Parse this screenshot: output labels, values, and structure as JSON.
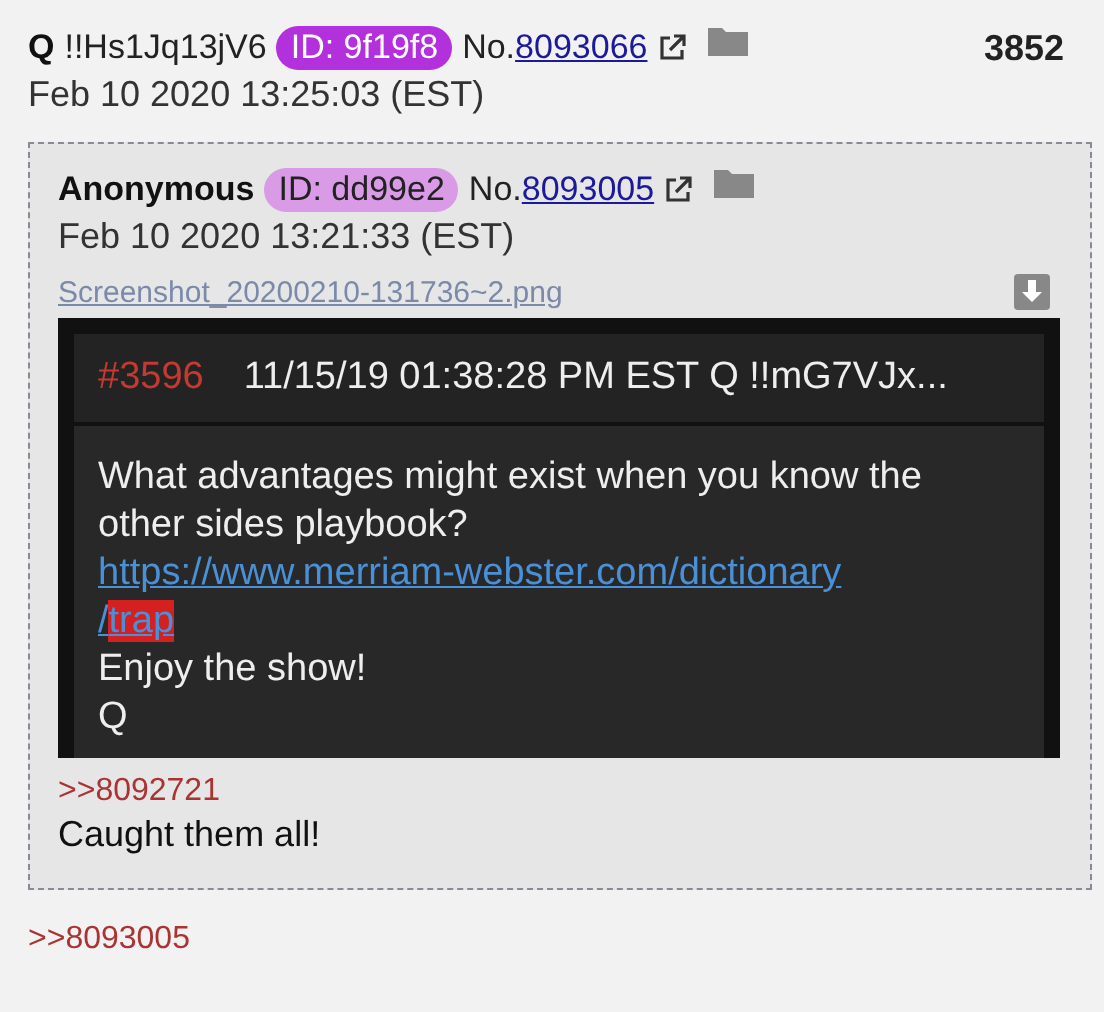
{
  "post": {
    "name": "Q",
    "tripcode": "!!Hs1Jq13jV6",
    "id_badge": {
      "text": "ID: 9f19f8",
      "color": "#b330dd"
    },
    "no_label": "No.",
    "number": "8093066",
    "count": "3852",
    "date": "Feb 10 2020 13:25:03 (EST)"
  },
  "quoted_post": {
    "name": "Anonymous",
    "id_badge": {
      "text": "ID: dd99e2",
      "color": "#d99be6"
    },
    "no_label": "No.",
    "number": "8093005",
    "date": "Feb 10 2020 13:21:33 (EST)",
    "file_name": "Screenshot_20200210-131736~2.png",
    "attachment": {
      "post_number": "#3596",
      "header": "11/15/19 01:38:28 PM EST Q !!mG7VJx...",
      "text": "What advantages might exist when you know the other sides playbook?",
      "link_lines": [
        [
          {
            "text": "https://www.merriam-webster.com/dictionary",
            "highlighted": false
          }
        ],
        [
          {
            "text": "/",
            "highlighted": false
          },
          {
            "text": "trap",
            "highlighted": true
          }
        ]
      ],
      "lines": [
        "Enjoy the show!",
        "Q"
      ]
    },
    "reply_link": ">>8092721",
    "message": "Caught them all!"
  },
  "reply_link": ">>8093005"
}
